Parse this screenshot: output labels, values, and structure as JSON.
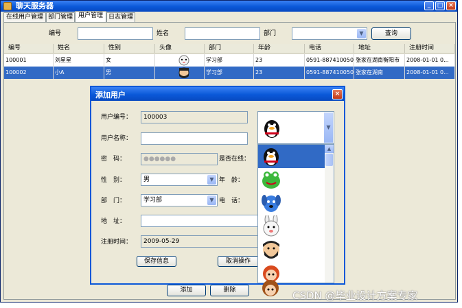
{
  "window": {
    "title": "聊天服务器",
    "min_label": "_",
    "max_label": "□",
    "close_label": "×"
  },
  "tabs": [
    {
      "label": "在线用户管理"
    },
    {
      "label": "部门管理"
    },
    {
      "label": "用户管理"
    },
    {
      "label": "日志管理"
    }
  ],
  "search": {
    "id_label": "编号",
    "name_label": "姓名",
    "dept_label": "部门",
    "id_value": "",
    "name_value": "",
    "dept_value": "",
    "query_button": "查询"
  },
  "table": {
    "columns": [
      "编号",
      "姓名",
      "性别",
      "头像",
      "部门",
      "年龄",
      "电话",
      "地址",
      "注册时间"
    ],
    "rows": [
      [
        "100001",
        "刘星星",
        "女",
        "",
        "学习部",
        "23",
        "0591-887410050",
        "张家在湖南衡阳市",
        "2008-01-01 0..."
      ],
      [
        "100002",
        "小A",
        "男",
        "",
        "学习部",
        "23",
        "0591-887410050",
        "张家在湖南",
        "2008-01-01 0..."
      ]
    ]
  },
  "bottom_buttons": {
    "add": "添加",
    "delete": "删除"
  },
  "dialog": {
    "title": "添加用户",
    "close_label": "×",
    "user_id_label": "用户编号：",
    "user_id_value": "100003",
    "user_name_label": "用户名称：",
    "user_name_value": "",
    "password_label": "密　码：",
    "password_value": "●●●●●●",
    "online_label": "是否在线：",
    "gender_label": "性　别：",
    "gender_value": "男",
    "age_label": "年　龄：",
    "dept_label": "部　门：",
    "dept_value": "学习部",
    "phone_label": "电　话：",
    "address_label": "地　址：",
    "address_value": "",
    "reg_time_label": "注册时间：",
    "reg_time_value": "2009-05-29",
    "save_button": "保存信息",
    "cancel_button": "取消操作"
  },
  "avatars": [
    "qq-penguin-icon",
    "green-frog-icon",
    "blue-dog-icon",
    "white-rabbit-icon",
    "bearded-man-icon",
    "red-hair-girl-icon",
    "brown-hair-boy-icon"
  ],
  "watermark": "CSDN @毕业设计方案专家",
  "colors": {
    "title_blue": "#0a58d8",
    "selection": "#316ac5",
    "window_bg": "#ece9d8"
  }
}
